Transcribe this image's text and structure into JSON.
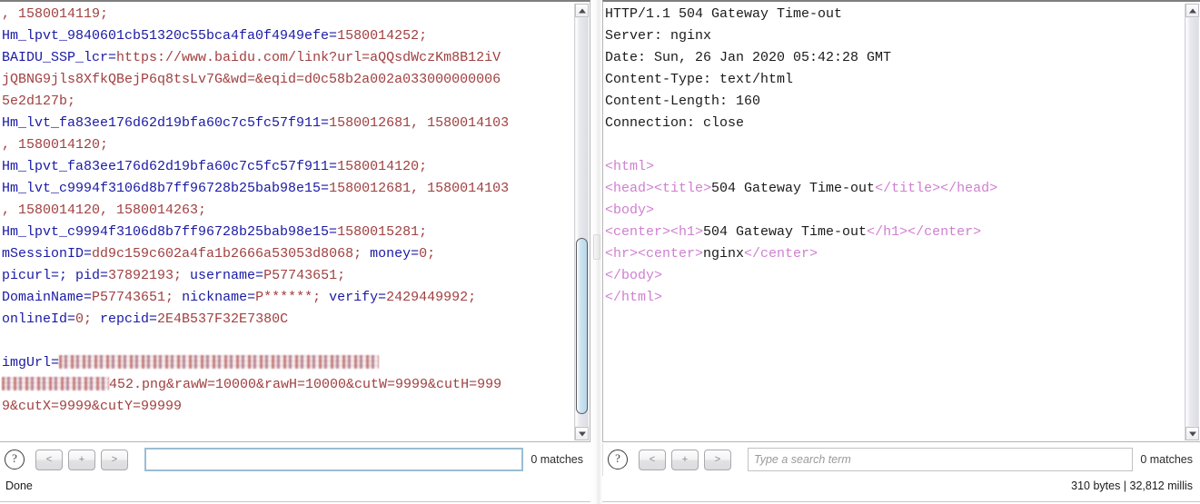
{
  "left_pane": {
    "name": "request-cookies-view",
    "lines": [
      [
        {
          "t": ", 1580014119;",
          "c": "k-val"
        }
      ],
      [
        {
          "t": "Hm_lpvt_9840601cb51320c55bca4fa0f4949efe=",
          "c": "k-name"
        },
        {
          "t": "1580014252;",
          "c": "k-val"
        }
      ],
      [
        {
          "t": "BAIDU_SSP_lcr=",
          "c": "k-name"
        },
        {
          "t": "https://www.baidu.com/link?url=aQQsdWczKm8B12iV",
          "c": "k-val"
        }
      ],
      [
        {
          "t": "jQBNG9jls8XfkQBejP6q8tsLv7G&wd=&eqid=d0c58b2a002a033000000006",
          "c": "k-val"
        }
      ],
      [
        {
          "t": "5e2d127b;",
          "c": "k-val"
        }
      ],
      [
        {
          "t": "Hm_lvt_fa83ee176d62d19bfa60c7c5fc57f911=",
          "c": "k-name"
        },
        {
          "t": "1580012681, 1580014103",
          "c": "k-val"
        }
      ],
      [
        {
          "t": ", 1580014120;",
          "c": "k-val"
        }
      ],
      [
        {
          "t": "Hm_lpvt_fa83ee176d62d19bfa60c7c5fc57f911=",
          "c": "k-name"
        },
        {
          "t": "1580014120;",
          "c": "k-val"
        }
      ],
      [
        {
          "t": "Hm_lvt_c9994f3106d8b7ff96728b25bab98e15=",
          "c": "k-name"
        },
        {
          "t": "1580012681, 1580014103",
          "c": "k-val"
        }
      ],
      [
        {
          "t": ", 1580014120, 1580014263;",
          "c": "k-val"
        }
      ],
      [
        {
          "t": "Hm_lpvt_c9994f3106d8b7ff96728b25bab98e15=",
          "c": "k-name"
        },
        {
          "t": "1580015281;",
          "c": "k-val"
        }
      ],
      [
        {
          "t": "mSessionID=",
          "c": "k-name"
        },
        {
          "t": "dd9c159c602a4fa1b2666a53053d8068; ",
          "c": "k-val"
        },
        {
          "t": "money=",
          "c": "k-name"
        },
        {
          "t": "0;",
          "c": "k-val"
        }
      ],
      [
        {
          "t": "picurl=; ",
          "c": "k-name"
        },
        {
          "t": "pid=",
          "c": "k-name"
        },
        {
          "t": "37892193; ",
          "c": "k-val"
        },
        {
          "t": "username=",
          "c": "k-name"
        },
        {
          "t": "P57743651;",
          "c": "k-val"
        }
      ],
      [
        {
          "t": "DomainName=",
          "c": "k-name"
        },
        {
          "t": "P57743651; ",
          "c": "k-val"
        },
        {
          "t": "nickname=",
          "c": "k-name"
        },
        {
          "t": "P******; ",
          "c": "k-val"
        },
        {
          "t": "verify=",
          "c": "k-name"
        },
        {
          "t": "2429449992;",
          "c": "k-val"
        }
      ],
      [
        {
          "t": "onlineId=",
          "c": "k-name"
        },
        {
          "t": "0; ",
          "c": "k-val"
        },
        {
          "t": "repcid=",
          "c": "k-name"
        },
        {
          "t": "2E4B537F32E7380C",
          "c": "k-val"
        }
      ],
      [],
      [
        {
          "t": "imgUrl=",
          "c": "k-name"
        },
        {
          "redact": 1
        }
      ],
      [
        {
          "redact": 2
        },
        {
          "t": "452.png&rawW=10000&rawH=10000&cutW=9999&cutH=999",
          "c": "k-val"
        }
      ],
      [
        {
          "t": "9&cutX=9999&cutY=99999",
          "c": "k-val"
        }
      ]
    ],
    "scrollbar": {
      "thumb_top_pct": 54,
      "thumb_height_pct": 43
    }
  },
  "right_pane": {
    "name": "response-view",
    "lines": [
      [
        {
          "t": "HTTP/1.1 504 Gateway Time-out",
          "c": "k-txt"
        }
      ],
      [
        {
          "t": "Server: nginx",
          "c": "k-txt"
        }
      ],
      [
        {
          "t": "Date: Sun, 26 Jan 2020 05:42:28 GMT",
          "c": "k-txt"
        }
      ],
      [
        {
          "t": "Content-Type: text/html",
          "c": "k-txt"
        }
      ],
      [
        {
          "t": "Content-Length: 160",
          "c": "k-txt"
        }
      ],
      [
        {
          "t": "Connection: close",
          "c": "k-txt"
        }
      ],
      [],
      [
        {
          "t": "<html>",
          "c": "k-tag"
        }
      ],
      [
        {
          "t": "<head><title>",
          "c": "k-tag"
        },
        {
          "t": "504 Gateway Time-out",
          "c": "k-txt"
        },
        {
          "t": "</title></head>",
          "c": "k-tag"
        }
      ],
      [
        {
          "t": "<body>",
          "c": "k-tag"
        }
      ],
      [
        {
          "t": "<center><h1>",
          "c": "k-tag"
        },
        {
          "t": "504 Gateway Time-out",
          "c": "k-txt"
        },
        {
          "t": "</h1></center>",
          "c": "k-tag"
        }
      ],
      [
        {
          "t": "<hr><center>",
          "c": "k-tag"
        },
        {
          "t": "nginx",
          "c": "k-txt"
        },
        {
          "t": "</center>",
          "c": "k-tag"
        }
      ],
      [
        {
          "t": "</body>",
          "c": "k-tag"
        }
      ],
      [
        {
          "t": "</html>",
          "c": "k-tag"
        }
      ]
    ],
    "scrollbar": {
      "thumb_top_pct": 0,
      "thumb_height_pct": 0
    }
  },
  "left_findbar": {
    "help_glyph": "?",
    "prev_label": "<",
    "add_label": "+",
    "next_label": ">",
    "search_value": "",
    "search_placeholder": "",
    "matches_label": "0 matches"
  },
  "right_findbar": {
    "help_glyph": "?",
    "prev_label": "<",
    "add_label": "+",
    "next_label": ">",
    "search_value": "",
    "search_placeholder": "Type a search term",
    "matches_label": "0 matches"
  },
  "statusbar": {
    "left_text": "Done",
    "right_text": "310 bytes | 32,812 millis"
  },
  "colors": {
    "cookie_name": "#1a1aa6",
    "cookie_value": "#a14040",
    "html_tag": "#d07fd0",
    "plain_text": "#1a1a1a",
    "scroll_thumb": "#b8d8ea"
  }
}
